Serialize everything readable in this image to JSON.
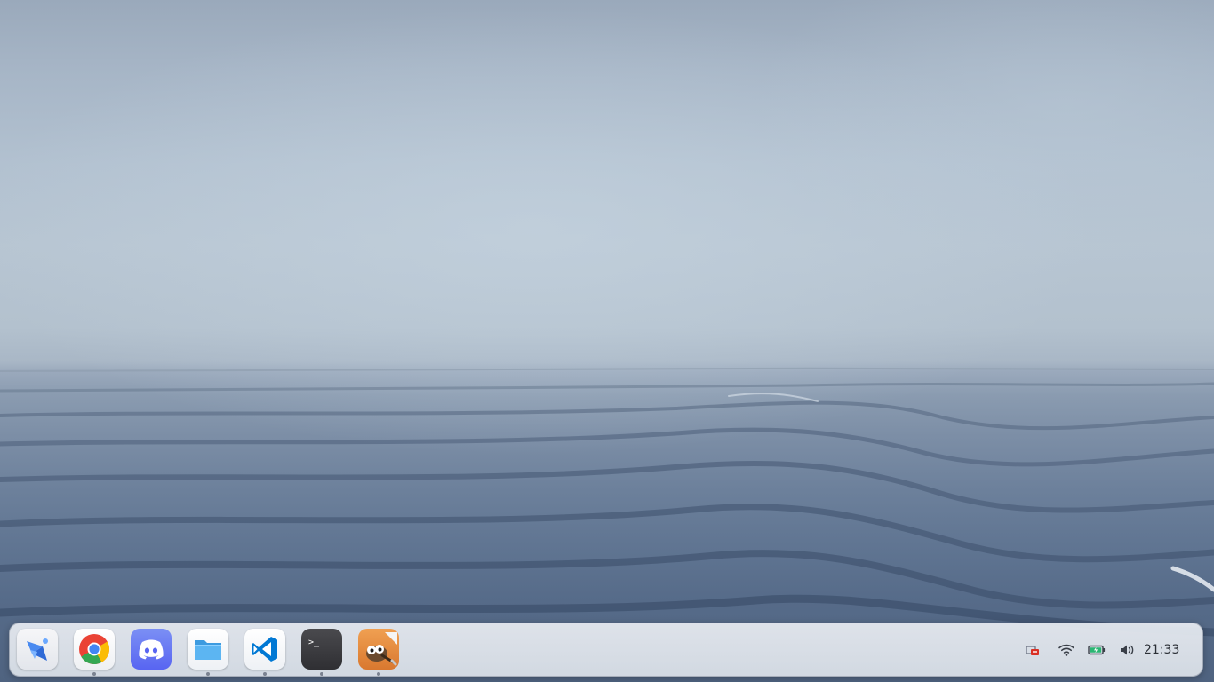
{
  "wallpaper": {
    "subject": "foggy-sea-waves"
  },
  "dock": {
    "apps": [
      {
        "name": "launcher",
        "icon": "launcher-icon",
        "running": false
      },
      {
        "name": "chrome",
        "icon": "chrome-icon",
        "running": true
      },
      {
        "name": "discord",
        "icon": "discord-icon",
        "running": false
      },
      {
        "name": "files",
        "icon": "folder-icon",
        "running": true
      },
      {
        "name": "vscode",
        "icon": "vscode-icon",
        "running": true
      },
      {
        "name": "terminal",
        "icon": "terminal-icon",
        "running": true
      },
      {
        "name": "gimp",
        "icon": "gimp-icon",
        "running": true
      }
    ],
    "terminal_glyph": ">_"
  },
  "tray": {
    "icons": [
      "network-disconnected-icon",
      "wifi-icon",
      "battery-charging-icon",
      "volume-icon"
    ],
    "clock": "21:33"
  },
  "colors": {
    "chrome_red": "#ea4335",
    "chrome_yellow": "#fbbc05",
    "chrome_green": "#34a853",
    "chrome_blue": "#4285f4",
    "discord": "#5865f2",
    "vscode": "#0078d4",
    "gimp": "#e08b3b",
    "battery_green": "#2bb673",
    "network_red": "#d93025"
  }
}
